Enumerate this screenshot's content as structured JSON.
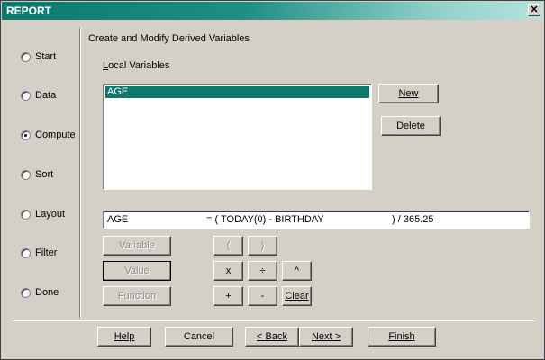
{
  "window": {
    "title": "REPORT",
    "close_symbol": "✕"
  },
  "nav": {
    "items": [
      {
        "label": "Start",
        "checked": false
      },
      {
        "label": "Data",
        "checked": false
      },
      {
        "label": "Compute",
        "checked": true
      },
      {
        "label": "Sort",
        "checked": false
      },
      {
        "label": "Layout",
        "checked": false
      },
      {
        "label": "Filter",
        "checked": false
      },
      {
        "label": "Done",
        "checked": false
      }
    ]
  },
  "main": {
    "section_title": "Create and Modify Derived Variables",
    "local_vars_label_first": "L",
    "local_vars_label_rest": "ocal Variables",
    "variables": [
      {
        "name": "AGE",
        "selected": true
      }
    ],
    "new_button": "New",
    "delete_button": "Delete",
    "expression": {
      "variable": "AGE",
      "formula": "= ( TODAY(0) - BIRTHDAY",
      "tail": ") / 365.25"
    },
    "insert_buttons": {
      "variable": "Variable",
      "value": "Value",
      "function": "Function"
    },
    "operators": {
      "lparen": "(",
      "rparen": ")",
      "multiply": "x",
      "divide": "÷",
      "power": "^",
      "plus": "+",
      "minus": "-",
      "clear": "Clear"
    }
  },
  "footer": {
    "help": "Help",
    "cancel": "Cancel",
    "back": "< Back",
    "next": "Next >",
    "finish": "Finish"
  }
}
